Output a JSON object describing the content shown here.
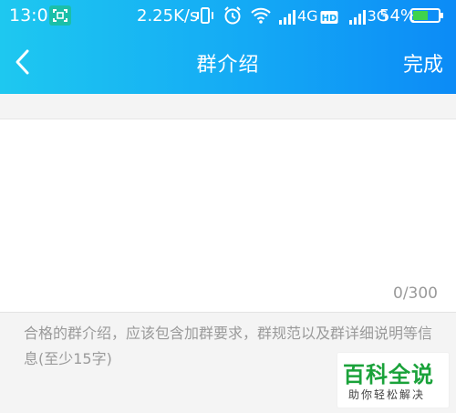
{
  "status_bar": {
    "time": "13:03",
    "net_speed": "2.25K/s",
    "network_a": "4G",
    "network_b": "3G",
    "battery_percent": "54%"
  },
  "nav": {
    "title": "群介绍",
    "done_label": "完成"
  },
  "editor": {
    "value": "",
    "char_count": "0/300"
  },
  "hint": "合格的群介绍，应该包含加群要求，群规范以及群详细说明等信息(至少15字)",
  "watermark": {
    "main": "百科全说",
    "sub": "助你轻松解决"
  },
  "colors": {
    "header_start": "#1ec8f0",
    "header_end": "#0c8bf6",
    "watermark_green": "#1aa23a"
  }
}
